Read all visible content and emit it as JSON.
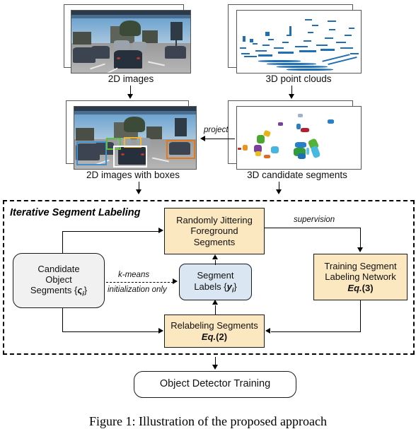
{
  "figure": {
    "caption": "Figure 1: Illustration of the proposed approach"
  },
  "panels": {
    "images_2d": {
      "label": "2D images"
    },
    "point_clouds_3d": {
      "label": "3D point clouds"
    },
    "images_2d_boxes": {
      "label": "2D images with boxes"
    },
    "candidate_segments_3d": {
      "label": "3D candidate segments"
    }
  },
  "edges": {
    "project": "project",
    "kmeans": "k-means",
    "initialization_only": "initialization only",
    "supervision": "supervision"
  },
  "diagram": {
    "section_title": "Iterative Segment Labeling",
    "nodes": {
      "jitter": {
        "line1": "Randomly Jittering",
        "line2": "Foreground",
        "line3": "Segments"
      },
      "candidate": {
        "line1": "Candidate",
        "line2": "Object",
        "line3_pre": "Segments {",
        "line3_sym": "ς",
        "line3_sub": "i",
        "line3_post": "}"
      },
      "labels": {
        "line1": "Segment",
        "line2_pre": "Labels {",
        "line2_sym": "y",
        "line2_sub": "i",
        "line2_post": "}"
      },
      "training": {
        "line1": "Training Segment",
        "line2": "Labeling Network",
        "eq_name": "Eq.",
        "eq_num": "(3)"
      },
      "relabel": {
        "line1": "Relabeling Segments",
        "eq_name": "Eq.",
        "eq_num": "(2)"
      }
    },
    "detector": {
      "label": "Object Detector Training"
    }
  },
  "colors": {
    "node_yellow": "#fbe7c0",
    "node_blue": "#dae6f2",
    "node_gray": "#f1f1f1",
    "lidar_point": "#1f6fb4",
    "bbox_blue": "#3d8fd0",
    "bbox_green": "#5fbf3f",
    "bbox_yellow": "#f0b82a",
    "bbox_white": "#ffffff",
    "bbox_orange": "#e07a1f"
  },
  "bboxes_2d": [
    {
      "name": "bbox-blue",
      "color": "#3d8fd0"
    },
    {
      "name": "bbox-green",
      "color": "#5fbf3f"
    },
    {
      "name": "bbox-yellow",
      "color": "#f0b82a"
    },
    {
      "name": "bbox-white",
      "color": "#ffffff"
    },
    {
      "name": "bbox-orange",
      "color": "#e07a1f"
    }
  ]
}
